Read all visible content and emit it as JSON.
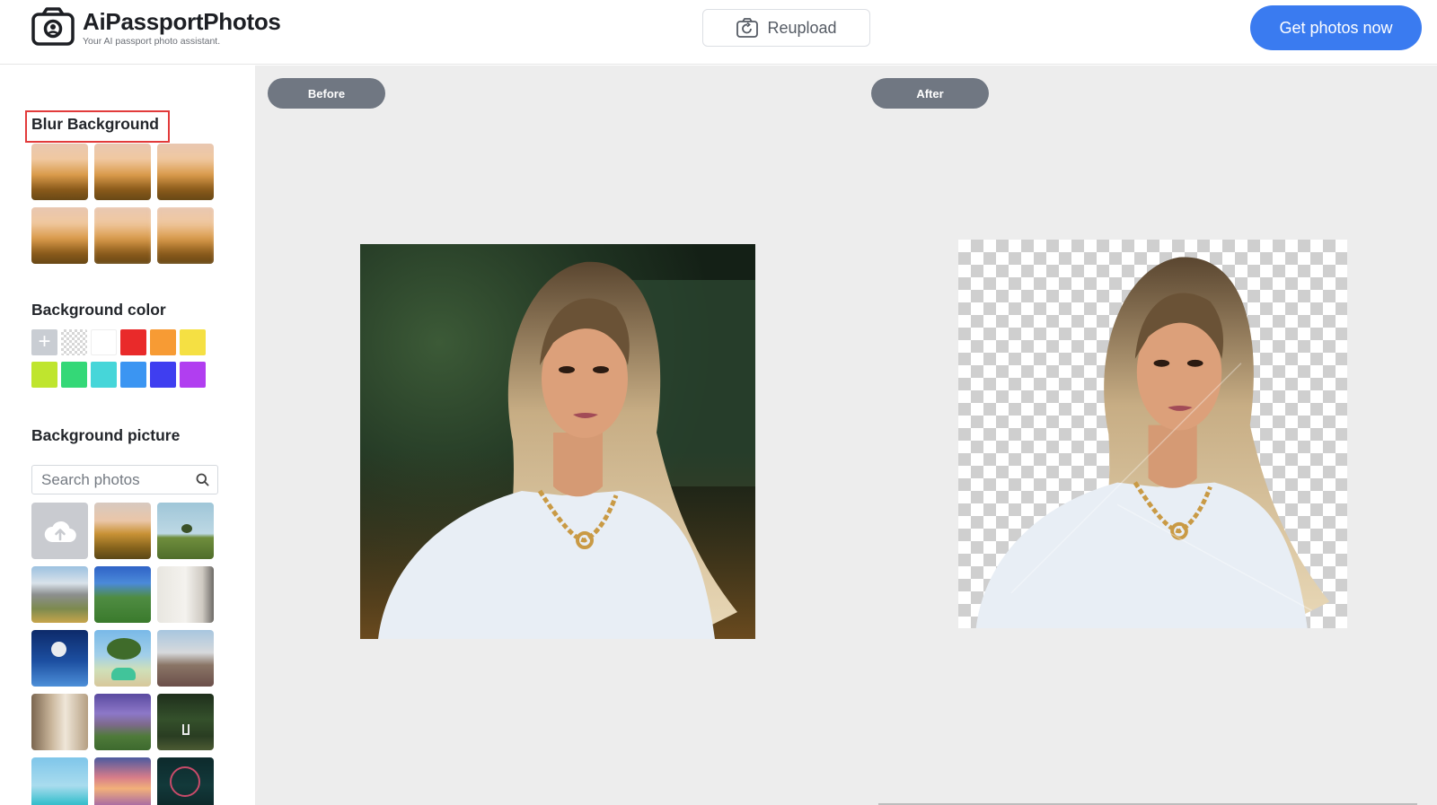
{
  "header": {
    "brand_name": "AiPassportPhotos",
    "brand_tagline": "Your AI passport photo assistant.",
    "reupload_label": "Reupload",
    "cta_label": "Get photos now"
  },
  "sidebar": {
    "blur_title": "Blur Background",
    "blur_levels": [
      "light",
      "light",
      "medium",
      "medium",
      "strong",
      "strong"
    ],
    "color_title": "Background color",
    "color_swatches": [
      {
        "name": "add",
        "color": "#c9cdd3"
      },
      {
        "name": "transparent",
        "color": "transparent"
      },
      {
        "name": "white",
        "color": "#ffffff"
      },
      {
        "name": "red",
        "color": "#e92a2a"
      },
      {
        "name": "orange",
        "color": "#f79b34"
      },
      {
        "name": "yellow",
        "color": "#f5e043"
      },
      {
        "name": "lime",
        "color": "#bfe52e"
      },
      {
        "name": "green",
        "color": "#34d877"
      },
      {
        "name": "cyan",
        "color": "#46d6d9"
      },
      {
        "name": "blue",
        "color": "#3b95f2"
      },
      {
        "name": "indigo",
        "color": "#3f3ef0"
      },
      {
        "name": "purple",
        "color": "#b13ef0"
      }
    ],
    "picture_title": "Background picture",
    "search_placeholder": "Search photos",
    "pictures": [
      "upload",
      "balloon-field",
      "lone-tree-field",
      "mountain-peaks",
      "green-valley",
      "indoor-shelf",
      "moon-sky",
      "green-car-tree",
      "lavender-field",
      "sunny-window",
      "purple-mountain-sunset",
      "garden-chair",
      "tropical-beach",
      "pink-sunset",
      "ferris-wheel-night"
    ]
  },
  "workspace": {
    "before_label": "Before",
    "after_label": "After"
  }
}
